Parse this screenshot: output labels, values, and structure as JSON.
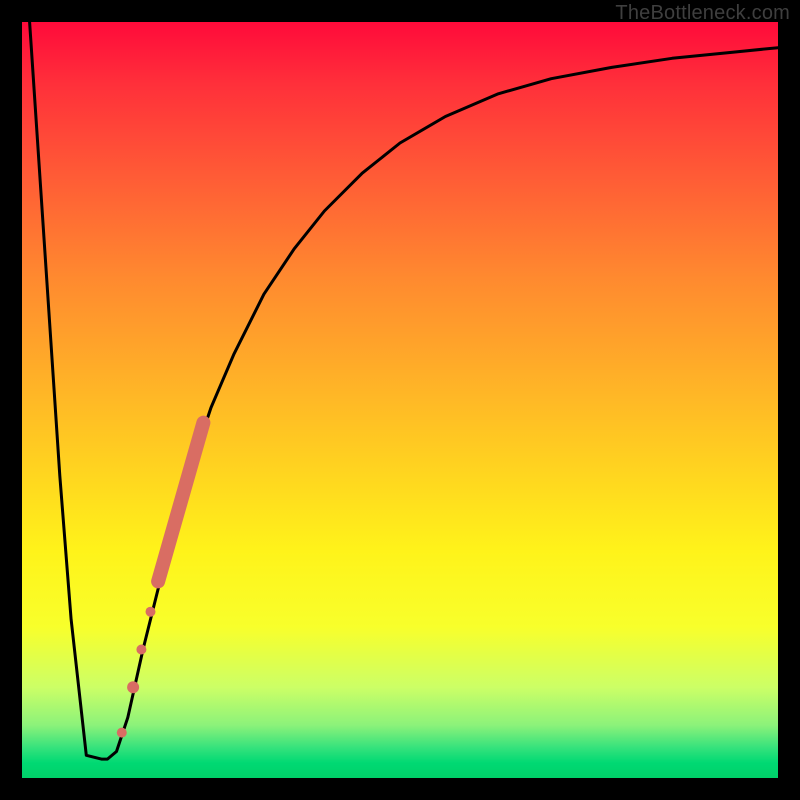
{
  "watermark": "TheBottleneck.com",
  "colors": {
    "curve": "#000000",
    "marker": "#d96d63",
    "frame": "#000000"
  },
  "chart_data": {
    "type": "line",
    "title": "",
    "xlabel": "",
    "ylabel": "",
    "xlim": [
      0,
      100
    ],
    "ylim": [
      0,
      100
    ],
    "grid": false,
    "series": [
      {
        "name": "bottleneck-curve",
        "x": [
          1,
          3,
          5,
          6.5,
          8.5,
          10.5,
          11.3,
          12.5,
          14,
          16,
          18,
          20,
          22,
          25,
          28,
          32,
          36,
          40,
          45,
          50,
          56,
          63,
          70,
          78,
          86,
          94,
          100
        ],
        "y": [
          100,
          70,
          40,
          21,
          3,
          2.5,
          2.5,
          3.5,
          8,
          17,
          25,
          33,
          40,
          49,
          56,
          64,
          70,
          75,
          80,
          84,
          87.5,
          90.5,
          92.5,
          94,
          95.2,
          96,
          96.6
        ]
      }
    ],
    "flat_min": {
      "x_range": [
        8.5,
        11.3
      ],
      "y": 2.5
    },
    "markers": {
      "type": "scatter",
      "shape": "circle",
      "color": "#d96d63",
      "points": [
        {
          "x": 13.2,
          "y": 6,
          "r": 5
        },
        {
          "x": 14.7,
          "y": 12,
          "r": 6
        },
        {
          "x": 15.8,
          "y": 17,
          "r": 5
        },
        {
          "x": 17.0,
          "y": 22,
          "r": 5
        }
      ],
      "thick_segment": {
        "x": [
          18.0,
          24.0
        ],
        "y": [
          26,
          47
        ],
        "width": 14
      }
    }
  }
}
